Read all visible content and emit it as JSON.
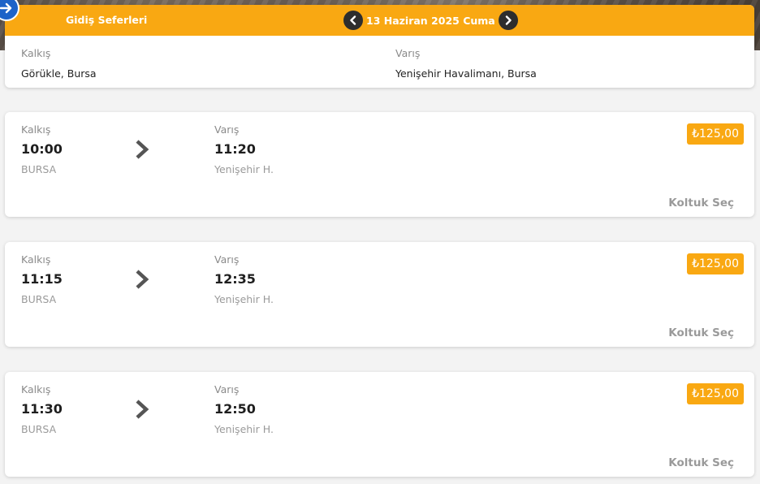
{
  "header": {
    "title": "Gidiş Seferleri",
    "date": "13 Haziran 2025 Cuma",
    "from_label": "Kalkış",
    "from_value": "Görükle, Bursa",
    "to_label": "Varış",
    "to_value": "Yenişehir Havalimanı, Bursa"
  },
  "trips": [
    {
      "dep_label": "Kalkış",
      "dep_time": "10:00",
      "dep_place": "BURSA",
      "arr_label": "Varış",
      "arr_time": "11:20",
      "arr_place": "Yenişehir H.",
      "price": "₺125,00",
      "action": "Koltuk Seç"
    },
    {
      "dep_label": "Kalkış",
      "dep_time": "11:15",
      "dep_place": "BURSA",
      "arr_label": "Varış",
      "arr_time": "12:35",
      "arr_place": "Yenişehir H.",
      "price": "₺125,00",
      "action": "Koltuk Seç"
    },
    {
      "dep_label": "Kalkış",
      "dep_time": "11:30",
      "dep_place": "BURSA",
      "arr_label": "Varış",
      "arr_time": "12:50",
      "arr_place": "Yenişehir H.",
      "price": "₺125,00",
      "action": "Koltuk Seç"
    }
  ],
  "colors": {
    "accent": "#f9a812",
    "back_button": "#1d63c8",
    "nav_button": "#2d2d2d"
  },
  "icons": {
    "back": "arrow-right-icon",
    "prev_date": "chevron-left-icon",
    "next_date": "chevron-right-icon",
    "trip_arrow": "chevron-right-icon"
  }
}
